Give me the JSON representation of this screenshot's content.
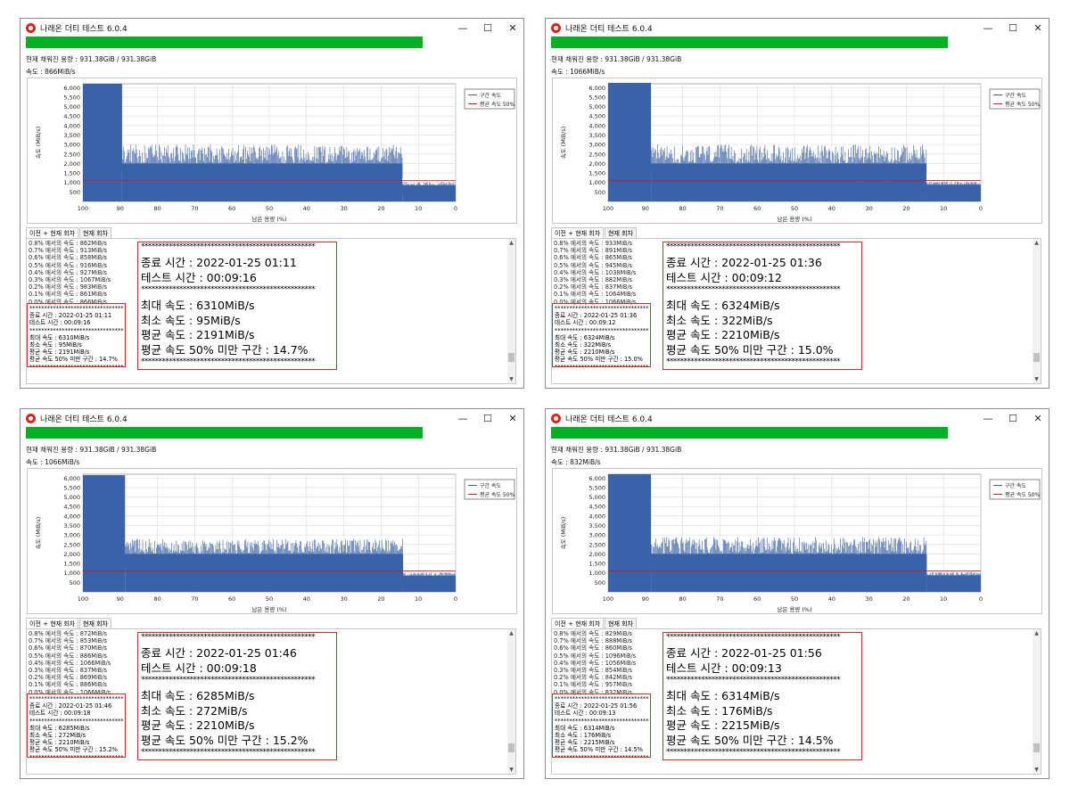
{
  "app": {
    "title": "나래온 더티 테스트 6.0.4",
    "buttons": {
      "minimize": "—",
      "maximize": "☐",
      "close": "✕"
    },
    "tabs": [
      "이전 + 현재 회차",
      "현재 회차"
    ],
    "colors": {
      "progress": "#06b025",
      "series": "#3a62a8",
      "avg_line": "#c81e1e",
      "highlight_box": "#d42b2b"
    }
  },
  "windows": [
    {
      "capacity": "현재 채워진 용량 : 931.38GiB / 931.38GiB",
      "speed": "속도 : 866MiB/s",
      "progress": 1.0,
      "log": [
        "0.8% 에서의 속도 : 862MiB/s",
        "0.7% 에서의 속도 : 913MiB/s",
        "0.6% 에서의 속도 : 858MiB/s",
        "0.5% 에서의 속도 : 916MiB/s",
        "0.4% 에서의 속도 : 927MiB/s",
        "0.3% 에서의 속도 : 1067MiB/s",
        "0.2% 에서의 속도 : 983MiB/s",
        "0.1% 에서의 속도 : 861MiB/s",
        "0.0% 에서의 속도 : 866MiB/s"
      ],
      "summary": {
        "end": "종료 시간 : 2022-01-25 01:11",
        "test": "테스트 시간 : 00:09:16",
        "max": "최대 속도 : 6310MiB/s",
        "min": "최소 속도 : 95MiB/s",
        "avg": "평균 속도 : 2191MiB/s",
        "below": "평균 속도 50% 미만 구간 : 14.7%"
      }
    },
    {
      "capacity": "현재 채워진 용량 : 931.38GiB / 931.38GiB",
      "speed": "속도 : 1066MiB/s",
      "progress": 1.0,
      "log": [
        "0.8% 에서의 속도 : 933MiB/s",
        "0.7% 에서의 속도 : 891MiB/s",
        "0.6% 에서의 속도 : 865MiB/s",
        "0.5% 에서의 속도 : 945MiB/s",
        "0.4% 에서의 속도 : 1038MiB/s",
        "0.3% 에서의 속도 : 882MiB/s",
        "0.2% 에서의 속도 : 837MiB/s",
        "0.1% 에서의 속도 : 1064MiB/s",
        "0.0% 에서의 속도 : 1066MiB/s"
      ],
      "summary": {
        "end": "종료 시간 : 2022-01-25 01:36",
        "test": "테스트 시간 : 00:09:12",
        "max": "최대 속도 : 6324MiB/s",
        "min": "최소 속도 : 322MiB/s",
        "avg": "평균 속도 : 2210MiB/s",
        "below": "평균 속도 50% 미만 구간 : 15.0%"
      }
    },
    {
      "capacity": "현재 채워진 용량 : 931.38GiB / 931.38GiB",
      "speed": "속도 : 1066MiB/s",
      "progress": 1.0,
      "log": [
        "0.8% 에서의 속도 : 872MiB/s",
        "0.7% 에서의 속도 : 853MiB/s",
        "0.6% 에서의 속도 : 870MiB/s",
        "0.5% 에서의 속도 : 886MiB/s",
        "0.4% 에서의 속도 : 1066MiB/s",
        "0.3% 에서의 속도 : 837MiB/s",
        "0.2% 에서의 속도 : 869MiB/s",
        "0.1% 에서의 속도 : 886MiB/s",
        "0.0% 에서의 속도 : 1066MiB/s"
      ],
      "summary": {
        "end": "종료 시간 : 2022-01-25 01:46",
        "test": "테스트 시간 : 00:09:18",
        "max": "최대 속도 : 6285MiB/s",
        "min": "최소 속도 : 272MiB/s",
        "avg": "평균 속도 : 2210MiB/s",
        "below": "평균 속도 50% 미만 구간 : 15.2%"
      }
    },
    {
      "capacity": "현재 채워진 용량 : 931.38GiB / 931.38GiB",
      "speed": "속도 : 832MiB/s",
      "progress": 1.0,
      "log": [
        "0.8% 에서의 속도 : 829MiB/s",
        "0.7% 에서의 속도 : 888MiB/s",
        "0.6% 에서의 속도 : 860MiB/s",
        "0.5% 에서의 속도 : 1096MiB/s",
        "0.4% 에서의 속도 : 1056MiB/s",
        "0.3% 에서의 속도 : 854MiB/s",
        "0.2% 에서의 속도 : 842MiB/s",
        "0.1% 에서의 속도 : 957MiB/s",
        "0.0% 에서의 속도 : 832MiB/s"
      ],
      "summary": {
        "end": "종료 시간 : 2022-01-25 01:56",
        "test": "테스트 시간 : 00:09:13",
        "max": "최대 속도 : 6314MiB/s",
        "min": "최소 속도 : 176MiB/s",
        "avg": "평균 속도 : 2215MiB/s",
        "below": "평균 속도 50% 미만 구간 : 14.5%"
      }
    }
  ],
  "chart_data": [
    {
      "type": "area",
      "xlabel": "남은 용량 (%)",
      "ylabel": "속도 (MiB/s)",
      "xlim": [
        100,
        0
      ],
      "ylim": [
        0,
        6200
      ],
      "xticks": [
        100,
        90,
        80,
        70,
        60,
        50,
        40,
        30,
        20,
        10,
        0
      ],
      "yticks": [
        500,
        1000,
        1500,
        2000,
        2500,
        3000,
        3500,
        4000,
        4500,
        5000,
        5500,
        6000
      ],
      "legend": [
        "구간 속도",
        "평균 속도 50%"
      ],
      "legend_position": "top-right",
      "grid": true,
      "series": [
        {
          "name": "구간 속도",
          "segments": [
            {
              "from": 100,
              "to": 89.5,
              "speed": 6200
            },
            {
              "from": 89.5,
              "to": 14.3,
              "speed": 2200,
              "spike_max": 3000
            },
            {
              "from": 14.3,
              "to": 0,
              "speed": 850
            }
          ]
        },
        {
          "name": "평균 속도 50%",
          "value": 1095
        }
      ]
    },
    {
      "type": "area",
      "xlabel": "남은 용량 (%)",
      "ylabel": "속도 (MiB/s)",
      "xlim": [
        100,
        0
      ],
      "ylim": [
        0,
        6200
      ],
      "xticks": [
        100,
        90,
        80,
        70,
        60,
        50,
        40,
        30,
        20,
        10,
        0
      ],
      "yticks": [
        500,
        1000,
        1500,
        2000,
        2500,
        3000,
        3500,
        4000,
        4500,
        5000,
        5500,
        6000
      ],
      "legend": [
        "구간 속도",
        "평균 속도 50%"
      ],
      "legend_position": "top-right",
      "grid": true,
      "series": [
        {
          "name": "구간 속도",
          "segments": [
            {
              "from": 100,
              "to": 88.5,
              "speed": 6250
            },
            {
              "from": 88.5,
              "to": 14.6,
              "speed": 2200,
              "spike_max": 3000
            },
            {
              "from": 14.6,
              "to": 0,
              "speed": 880
            }
          ]
        },
        {
          "name": "평균 속도 50%",
          "value": 1105
        }
      ]
    },
    {
      "type": "area",
      "xlabel": "남은 용량 (%)",
      "ylabel": "속도 (MiB/s)",
      "xlim": [
        100,
        0
      ],
      "ylim": [
        0,
        6200
      ],
      "xticks": [
        100,
        90,
        80,
        70,
        60,
        50,
        40,
        30,
        20,
        10,
        0
      ],
      "yticks": [
        500,
        1000,
        1500,
        2000,
        2500,
        3000,
        3500,
        4000,
        4500,
        5000,
        5500,
        6000
      ],
      "legend": [
        "구간 속도",
        "평균 속도 50%"
      ],
      "legend_position": "top-right",
      "grid": true,
      "series": [
        {
          "name": "구간 속도",
          "segments": [
            {
              "from": 100,
              "to": 88.7,
              "speed": 6150
            },
            {
              "from": 88.7,
              "to": 14.1,
              "speed": 2200,
              "spike_max": 2800
            },
            {
              "from": 14.1,
              "to": 0,
              "speed": 850
            }
          ]
        },
        {
          "name": "평균 속도 50%",
          "value": 1105
        }
      ]
    },
    {
      "type": "area",
      "xlabel": "남은 용량 (%)",
      "ylabel": "속도 (MiB/s)",
      "xlim": [
        100,
        0
      ],
      "ylim": [
        0,
        6200
      ],
      "xticks": [
        100,
        90,
        80,
        70,
        60,
        50,
        40,
        30,
        20,
        10,
        0
      ],
      "yticks": [
        500,
        1000,
        1500,
        2000,
        2500,
        3000,
        3500,
        4000,
        4500,
        5000,
        5500,
        6000
      ],
      "legend": [
        "구간 속도",
        "평균 속도 50%"
      ],
      "legend_position": "top-right",
      "grid": true,
      "series": [
        {
          "name": "구간 속도",
          "segments": [
            {
              "from": 100,
              "to": 88.5,
              "speed": 6200
            },
            {
              "from": 88.5,
              "to": 14.5,
              "speed": 2200,
              "spike_max": 2900
            },
            {
              "from": 14.5,
              "to": 0,
              "speed": 870
            }
          ]
        },
        {
          "name": "평균 속도 50%",
          "value": 1108
        }
      ]
    }
  ]
}
